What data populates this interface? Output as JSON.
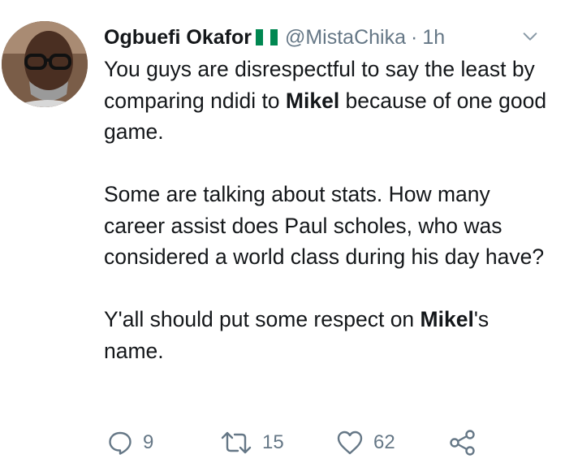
{
  "tweet": {
    "author_name": "Ogbuefi Okafor",
    "handle": "@MistaChika",
    "separator": "·",
    "time": "1h",
    "paragraphs": [
      {
        "before": "You guys are disrespectful to say the least by comparing ndidi to ",
        "bold": "Mikel",
        "after": " because of one good game."
      },
      {
        "text": "Some are talking about stats. How many career assist does Paul scholes, who was considered a world class during his day have?"
      },
      {
        "before": "Y'all should put some respect on ",
        "bold": "Mikel",
        "after": "'s name."
      }
    ],
    "actions": {
      "reply_count": "9",
      "retweet_count": "15",
      "like_count": "62"
    }
  },
  "icons": {
    "verified_flag": "nigeria-flag-icon",
    "menu": "chevron-down-icon",
    "reply": "reply-icon",
    "retweet": "retweet-icon",
    "like": "heart-icon",
    "share": "share-icon"
  },
  "colors": {
    "text": "#14171a",
    "secondary": "#657786",
    "flag_green": "#008751"
  }
}
